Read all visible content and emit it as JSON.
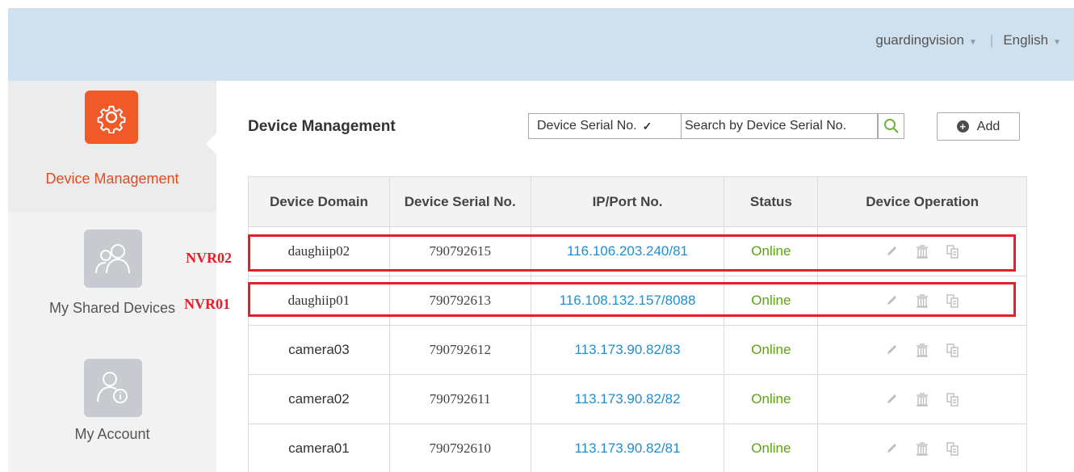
{
  "header": {
    "user": "guardingvision",
    "language": "English"
  },
  "sidebar": {
    "items": [
      {
        "label": "Device Management",
        "icon": "gear-icon",
        "active": true
      },
      {
        "label": "My Shared Devices",
        "icon": "users-icon",
        "active": false
      },
      {
        "label": "My Account",
        "icon": "account-info-icon",
        "active": false
      }
    ]
  },
  "main": {
    "title": "Device Management",
    "search": {
      "filter_value": "Device Serial No.",
      "placeholder": "Search by Device Serial No."
    },
    "add_label": "Add",
    "table": {
      "columns": [
        "Device Domain",
        "Device Serial No.",
        "IP/Port No.",
        "Status",
        "Device Operation"
      ],
      "rows": [
        {
          "domain": "daughiip02",
          "serial": "790792615",
          "ip": "116.106.203.240/81",
          "status": "Online"
        },
        {
          "domain": "daughiip01",
          "serial": "790792613",
          "ip": "116.108.132.157/8088",
          "status": "Online"
        },
        {
          "domain": "camera03",
          "serial": "790792612",
          "ip": "113.173.90.82/83",
          "status": "Online"
        },
        {
          "domain": "camera02",
          "serial": "790792611",
          "ip": "113.173.90.82/82",
          "status": "Online"
        },
        {
          "domain": "camera01",
          "serial": "790792610",
          "ip": "113.173.90.82/81",
          "status": "Online"
        }
      ]
    }
  },
  "annotations": {
    "nvr02": "NVR02",
    "nvr01": "NVR01",
    "highlight_color": "#e31f2a"
  },
  "colors": {
    "accent": "#f05a28",
    "link": "#1d8fd3",
    "online": "#5da30c",
    "header_bg": "#cfe0ef"
  }
}
